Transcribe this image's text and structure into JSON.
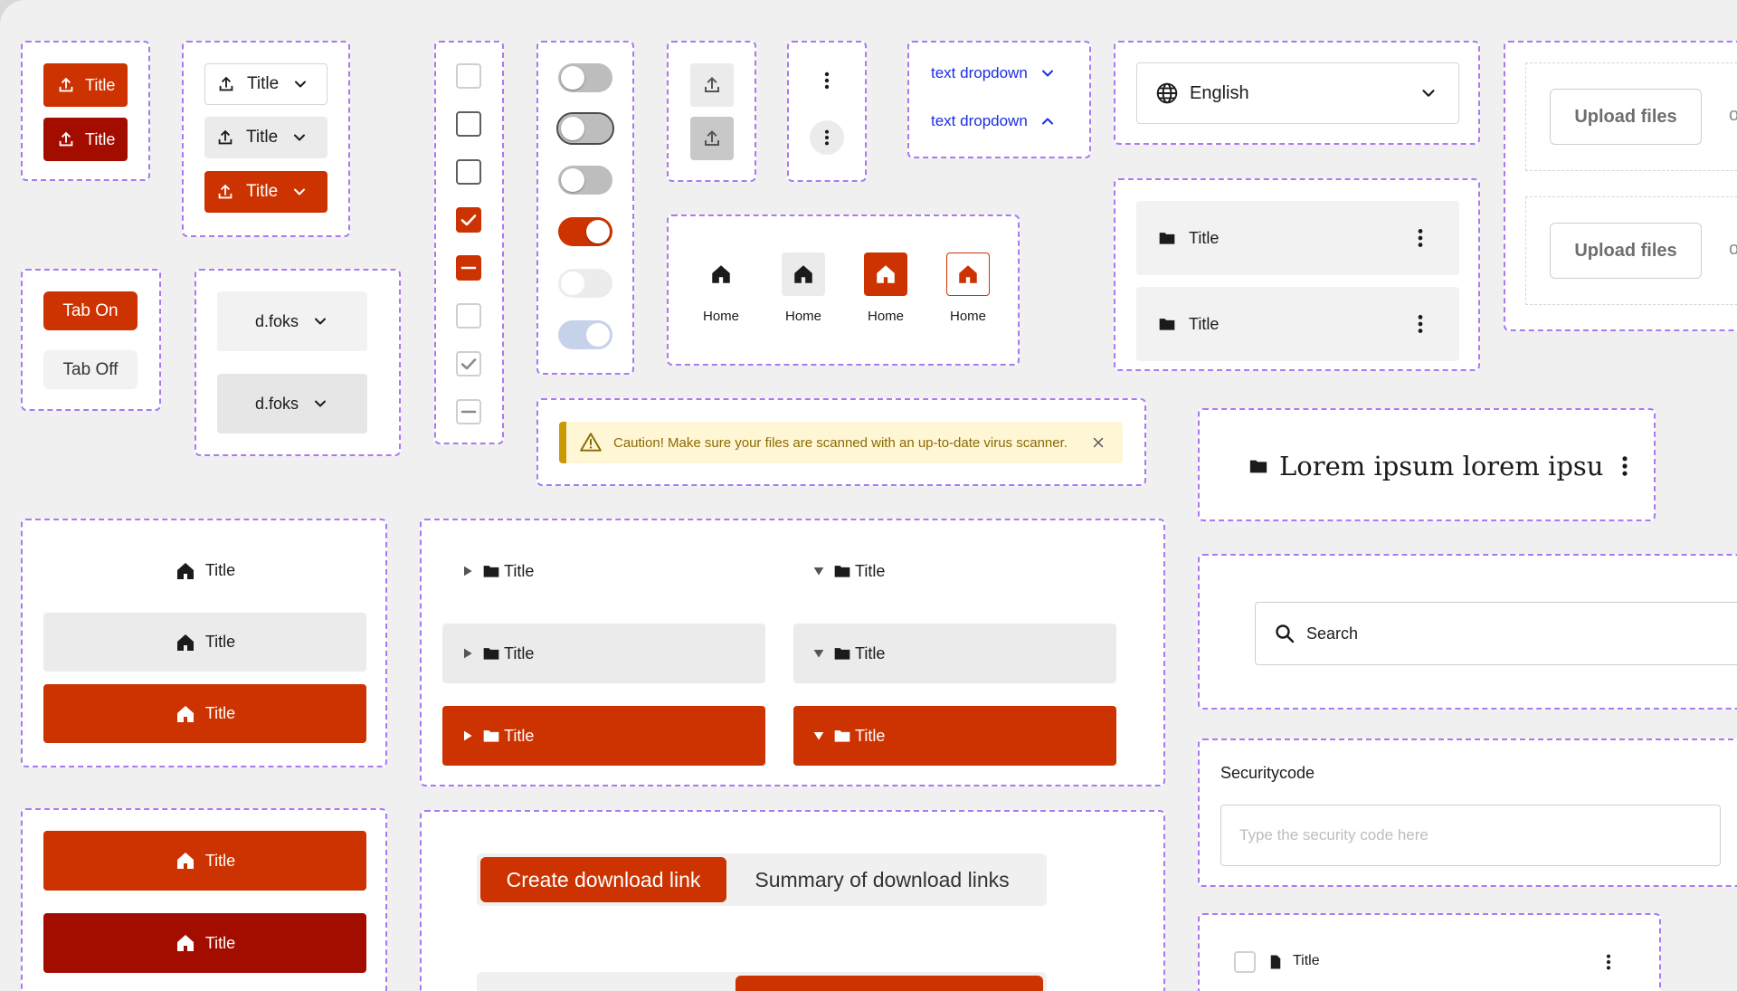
{
  "colors": {
    "accent": "#cc3300",
    "accent_dark": "#a30d00",
    "frame": "#a97af0",
    "link_blue": "#1b2ee0",
    "warning_bg": "#fff6d6",
    "warning_bar": "#c99a06"
  },
  "upload_buttons": {
    "label": "Title",
    "icon": "upload-icon"
  },
  "split_buttons": {
    "label": "Title",
    "icon": "chevron-down-icon"
  },
  "tabs": {
    "on": "Tab On",
    "off": "Tab Off"
  },
  "user_dropdowns": {
    "label": "d.foks"
  },
  "text_dropdowns": {
    "label": "text dropdown"
  },
  "language_select": {
    "value": "English",
    "icon": "globe-icon"
  },
  "upload_files": {
    "label": "Upload files",
    "trailing": "o"
  },
  "home_nav": {
    "label": "Home"
  },
  "folder_rows": {
    "label": "Title"
  },
  "warning": {
    "text": "Caution! Make sure your files are scanned with an up-to-date virus scanner."
  },
  "heading_card": {
    "text": "Lorem ipsum lorem ipsu"
  },
  "nav_list": {
    "label": "Title"
  },
  "tree_items": {
    "label": "Title"
  },
  "search": {
    "placeholder": "Search"
  },
  "security": {
    "label": "Securitycode",
    "placeholder": "Type the security code here"
  },
  "segmented": {
    "create": "Create download link",
    "summary": "Summary of download links"
  },
  "file_row": {
    "label": "Title"
  }
}
